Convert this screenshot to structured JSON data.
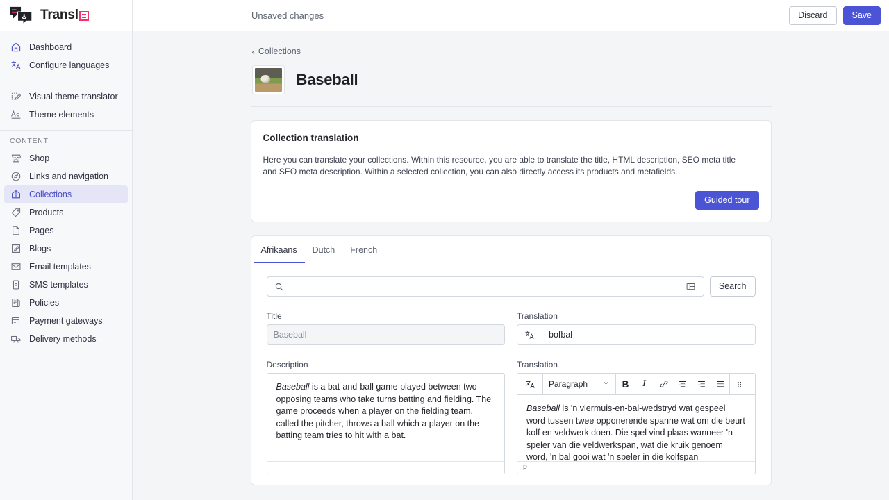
{
  "brand": {
    "name": "Transl",
    "mark_color": "#f4336d"
  },
  "topbar": {
    "status": "Unsaved changes",
    "discard_label": "Discard",
    "save_label": "Save",
    "save_color": "#4b54d4"
  },
  "sidebar": {
    "primary_items": [
      {
        "label": "Dashboard",
        "icon": "home-icon",
        "active": false
      },
      {
        "label": "Configure languages",
        "icon": "translate-icon",
        "active": false
      }
    ],
    "theme_items": [
      {
        "label": "Visual theme translator",
        "icon": "theme-translator-icon",
        "active": false
      },
      {
        "label": "Theme elements",
        "icon": "text-format-icon",
        "active": false
      }
    ],
    "content_heading": "CONTENT",
    "content_items": [
      {
        "label": "Shop",
        "icon": "shop-icon",
        "active": false
      },
      {
        "label": "Links and navigation",
        "icon": "compass-icon",
        "active": false
      },
      {
        "label": "Collections",
        "icon": "collections-icon",
        "active": true
      },
      {
        "label": "Products",
        "icon": "tag-icon",
        "active": false
      },
      {
        "label": "Pages",
        "icon": "page-icon",
        "active": false
      },
      {
        "label": "Blogs",
        "icon": "pencil-icon",
        "active": false
      },
      {
        "label": "Email templates",
        "icon": "envelope-icon",
        "active": false
      },
      {
        "label": "SMS templates",
        "icon": "phone-icon",
        "active": false
      },
      {
        "label": "Policies",
        "icon": "document-icon",
        "active": false
      },
      {
        "label": "Payment gateways",
        "icon": "credit-card-icon",
        "active": false
      },
      {
        "label": "Delivery methods",
        "icon": "truck-icon",
        "active": false
      }
    ]
  },
  "page": {
    "breadcrumb_label": "Collections",
    "resource_title": "Baseball",
    "thumbnail_alt": "baseball-collection-thumbnail"
  },
  "info_card": {
    "title": "Collection translation",
    "description": "Here you can translate your collections. Within this resource, you are able to translate the title, HTML description, SEO meta title and SEO meta description. Within a selected collection, you can also directly access its products and metafields.",
    "guided_tour_label": "Guided tour"
  },
  "language_tabs": [
    {
      "label": "Afrikaans",
      "active": true
    },
    {
      "label": "Dutch",
      "active": false
    },
    {
      "label": "French",
      "active": false
    }
  ],
  "search": {
    "value": "",
    "placeholder": "",
    "search_icon": "search-icon",
    "view_icon": "table-view-icon",
    "button_label": "Search"
  },
  "fields": {
    "title": {
      "label": "Title",
      "source_value": "Baseball",
      "translation_label": "Translation",
      "translation_value": "bofbal",
      "translate_icon": "translate-icon"
    },
    "description": {
      "label": "Description",
      "source_html_em": "Baseball",
      "source_text": " is a bat-and-ball game played between two opposing teams who take turns batting and fielding. The game proceeds when a player on the fielding team, called the pitcher, throws a ball which a player on the batting team tries to hit with a bat.",
      "source_status": "",
      "translation_label": "Translation",
      "translation_html_em": "Baseball",
      "translation_text": " is 'n vlermuis-en-bal-wedstryd wat gespeel word tussen twee opponerende spanne wat om die beurt kolf en veldwerk doen. Die spel vind plaas wanneer 'n speler van die veldwerkspan, wat die kruik genoem word, 'n bal gooi wat 'n speler in die kolfspan",
      "translation_status": "p"
    }
  },
  "editor_toolbar": {
    "translate_icon": "translate-icon",
    "block_format": "Paragraph",
    "chevron_icon": "chevron-down-icon",
    "bold_label": "B",
    "italic_label": "I",
    "buttons": [
      "link-icon",
      "align-center-icon",
      "align-right-icon",
      "align-justify-icon",
      "drag-handle-icon"
    ]
  }
}
